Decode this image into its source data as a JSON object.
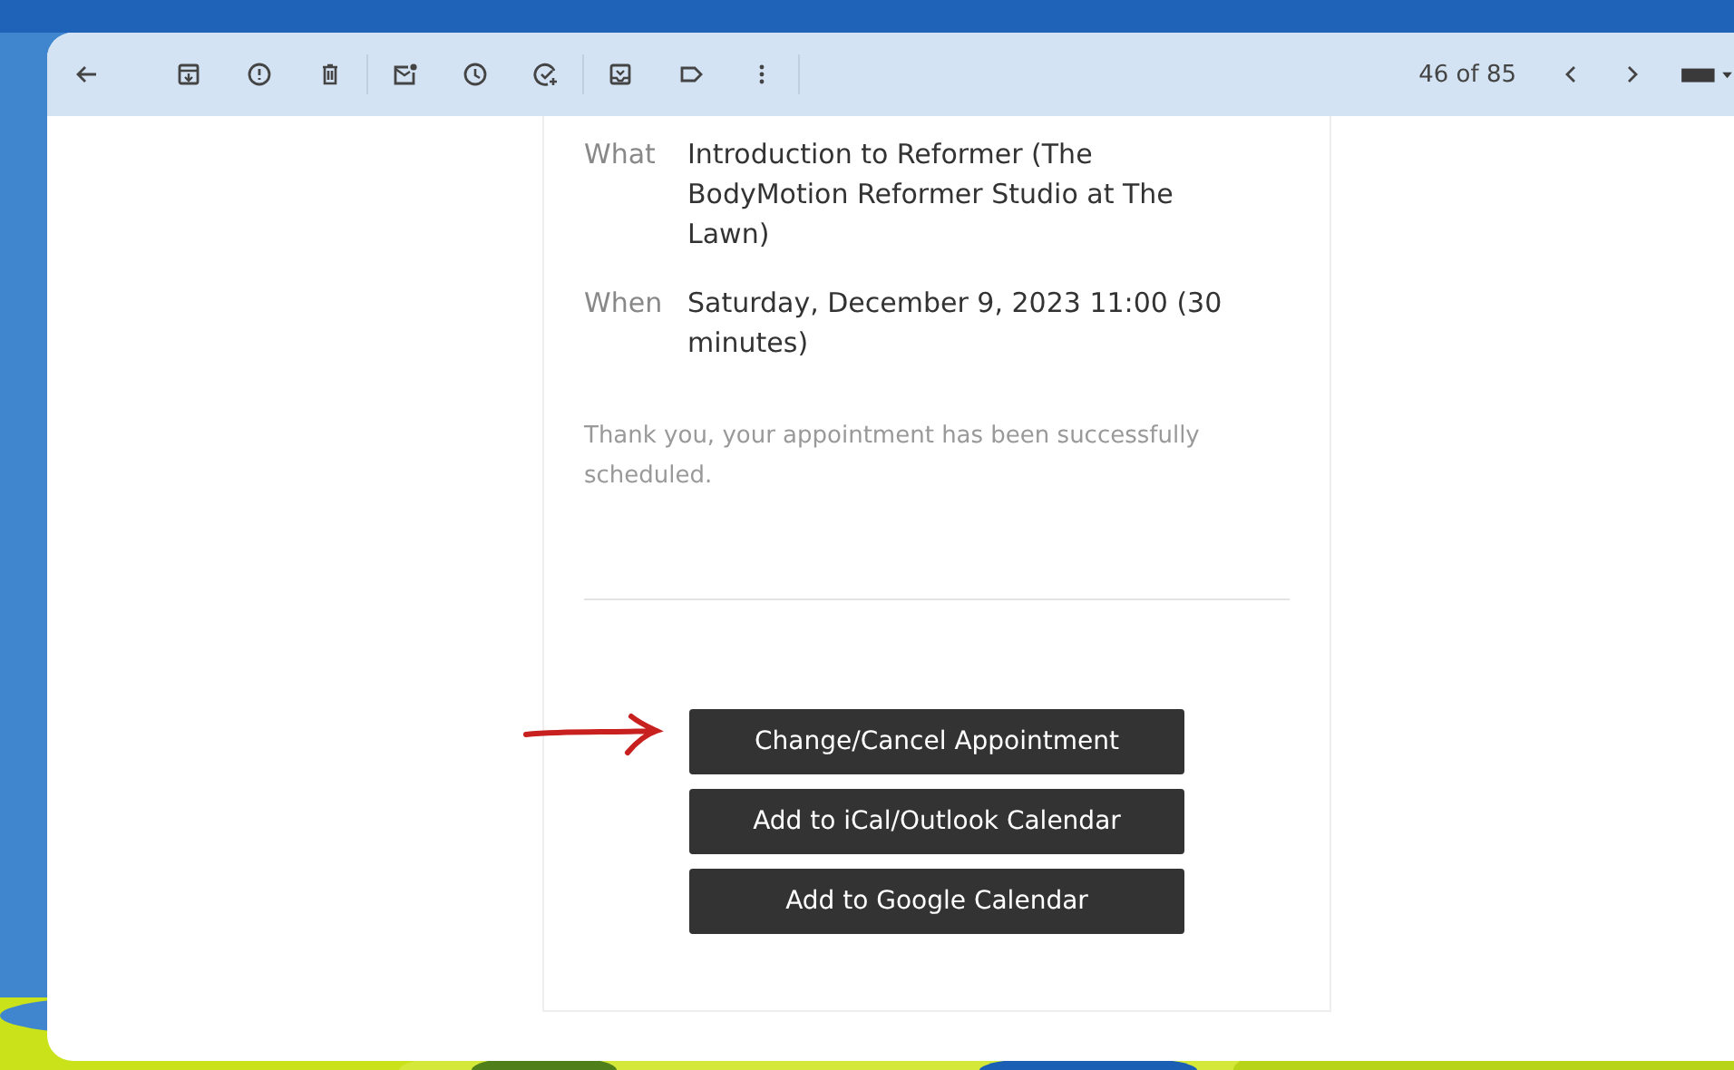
{
  "toolbar": {
    "counter": "46 of 85"
  },
  "email": {
    "details": [
      {
        "label": "What",
        "value": "Introduction to Reformer (The BodyMotion Reformer Studio at The Lawn)"
      },
      {
        "label": "When",
        "value": "Saturday, December 9, 2023 11:00 (30 minutes)"
      }
    ],
    "message": "Thank you, your appointment has been successfully scheduled.",
    "buttons": [
      "Change/Cancel Appointment",
      "Add to iCal/Outlook Calendar",
      "Add to Google Calendar"
    ]
  }
}
